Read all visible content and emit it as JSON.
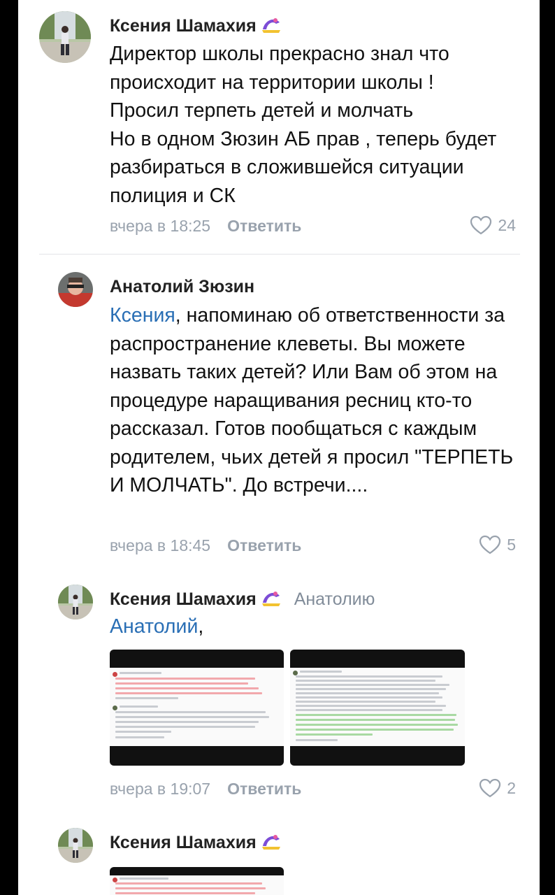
{
  "comments": [
    {
      "author": "Ксения Шамахия",
      "text": "Директор школы прекрасно знал что происходит на территории школы !\nПросил терпеть детей и молчать\nНо в одном Зюзин АБ прав , теперь будет разбираться в сложившейся ситуации полиция и СК",
      "time": "вчера в 18:25",
      "reply_label": "Ответить",
      "likes": "24"
    },
    {
      "author": "Анатолий Зюзин",
      "mention": "Ксения",
      "text": ",  напоминаю об ответственности за распространение клеветы. Вы можете назвать таких детей?  Или Вам об этом на процедуре наращивания ресниц кто-то рассказал. Готов пообщаться с каждым родителем, чьих детей я просил \"ТЕРПЕТЬ И МОЛЧАТЬ\". До встречи....",
      "time": "вчера в 18:45",
      "reply_label": "Ответить",
      "likes": "5"
    },
    {
      "author": "Ксения Шамахия",
      "reply_to": "Анатолию",
      "mention": "Анатолий",
      "text": ",",
      "time": "вчера в 19:07",
      "reply_label": "Ответить",
      "likes": "2"
    },
    {
      "author": "Ксения Шамахия"
    }
  ],
  "icons": {
    "like": "heart-outline-icon",
    "badge": "emoji-badge-icon"
  },
  "colors": {
    "mention": "#2a6fb5",
    "meta": "#99a2ad",
    "reply_to": "#818c99"
  }
}
